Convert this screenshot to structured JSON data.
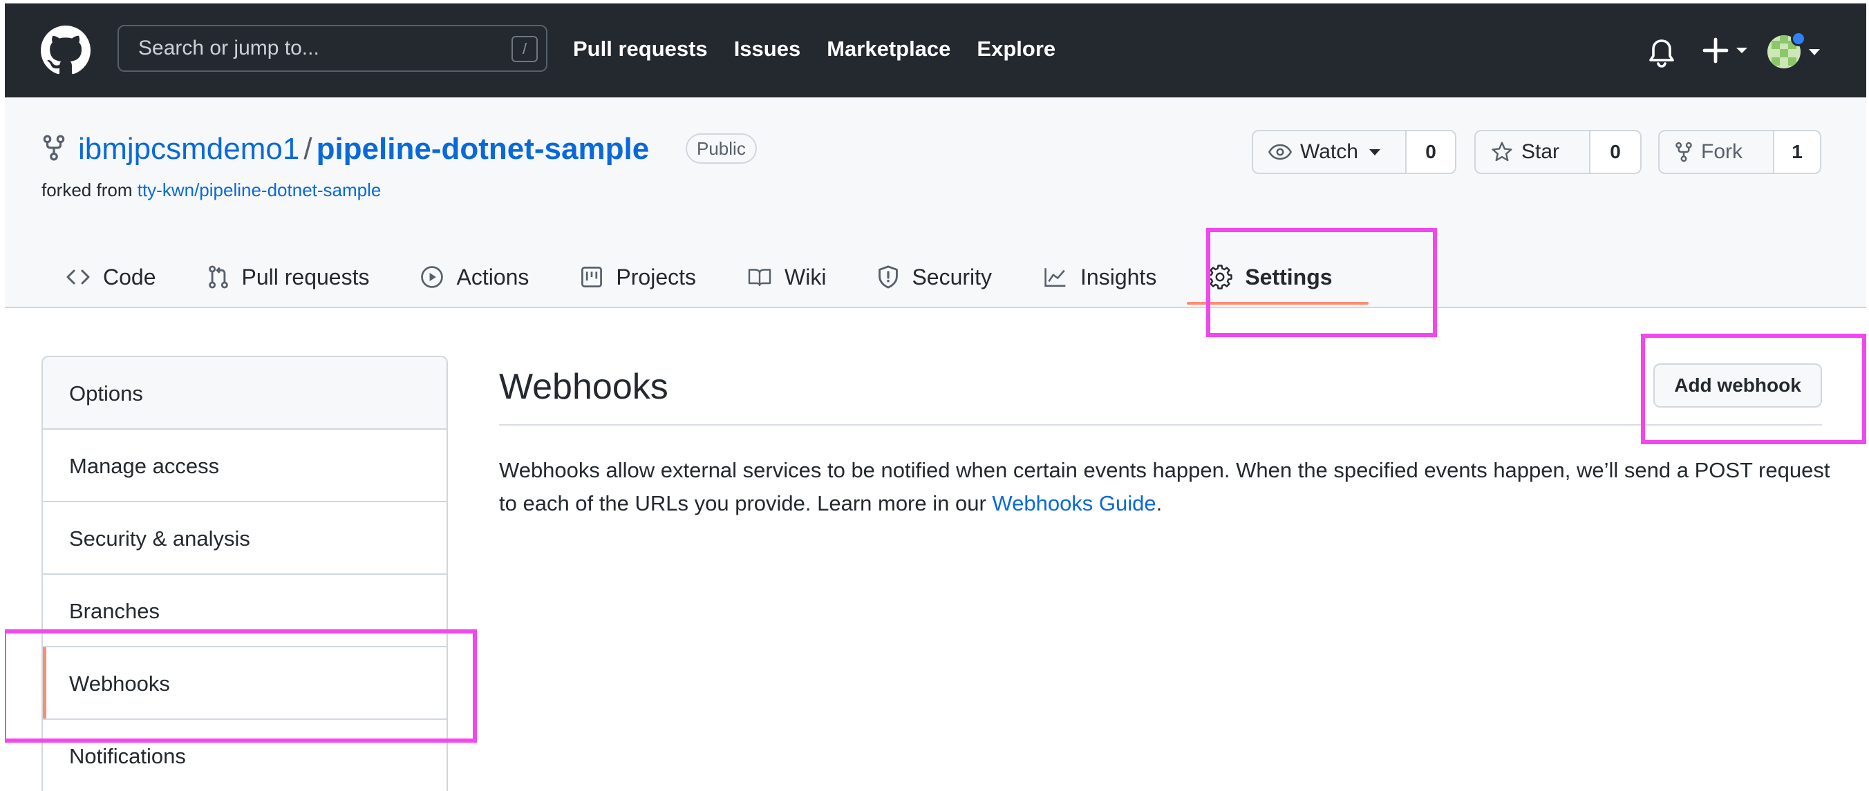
{
  "header": {
    "search_placeholder": "Search or jump to...",
    "slash_key": "/",
    "nav": [
      "Pull requests",
      "Issues",
      "Marketplace",
      "Explore"
    ]
  },
  "repo": {
    "owner": "ibmjpcsmdemo1",
    "separator": "/",
    "name": "pipeline-dotnet-sample",
    "visibility": "Public",
    "forked_from_prefix": "forked from",
    "forked_from_link": "tty-kwn/pipeline-dotnet-sample",
    "watch": {
      "label": "Watch",
      "count": "0"
    },
    "star": {
      "label": "Star",
      "count": "0"
    },
    "fork": {
      "label": "Fork",
      "count": "1"
    }
  },
  "tabs": [
    {
      "label": "Code",
      "icon": "code-icon"
    },
    {
      "label": "Pull requests",
      "icon": "pull-request-icon"
    },
    {
      "label": "Actions",
      "icon": "play-icon"
    },
    {
      "label": "Projects",
      "icon": "project-icon"
    },
    {
      "label": "Wiki",
      "icon": "book-icon"
    },
    {
      "label": "Security",
      "icon": "shield-icon"
    },
    {
      "label": "Insights",
      "icon": "graph-icon"
    },
    {
      "label": "Settings",
      "icon": "gear-icon",
      "active": true
    }
  ],
  "sidebar": {
    "items": [
      "Options",
      "Manage access",
      "Security & analysis",
      "Branches",
      "Webhooks",
      "Notifications"
    ],
    "active": "Webhooks"
  },
  "main": {
    "title": "Webhooks",
    "add_button": "Add webhook",
    "description_text": "Webhooks allow external services to be notified when certain events happen. When the specified events happen, we’ll send a POST request to each of the URLs you provide. Learn more in our ",
    "description_link": "Webhooks Guide",
    "description_end": "."
  },
  "colors": {
    "highlight": "#f246ee",
    "link": "#0969da",
    "active_underline": "#fd8c73",
    "topbar": "#24292f"
  }
}
